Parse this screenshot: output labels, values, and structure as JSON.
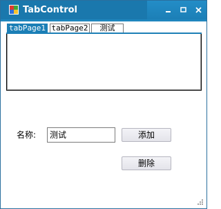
{
  "window": {
    "title": "TabControl",
    "controls": {
      "minimize": "▬",
      "maximize": "□",
      "close": "✕"
    }
  },
  "tabs": [
    {
      "label": "tabPage1",
      "active": true
    },
    {
      "label": "tabPage2",
      "active": false
    },
    {
      "label": "测试",
      "active": false
    }
  ],
  "form": {
    "name_label": "名称:",
    "name_value": "测试",
    "add_label": "添加",
    "delete_label": "删除"
  },
  "colors": {
    "title_bar": "#1c7fb6",
    "active_tab": "#1c7fb6"
  }
}
